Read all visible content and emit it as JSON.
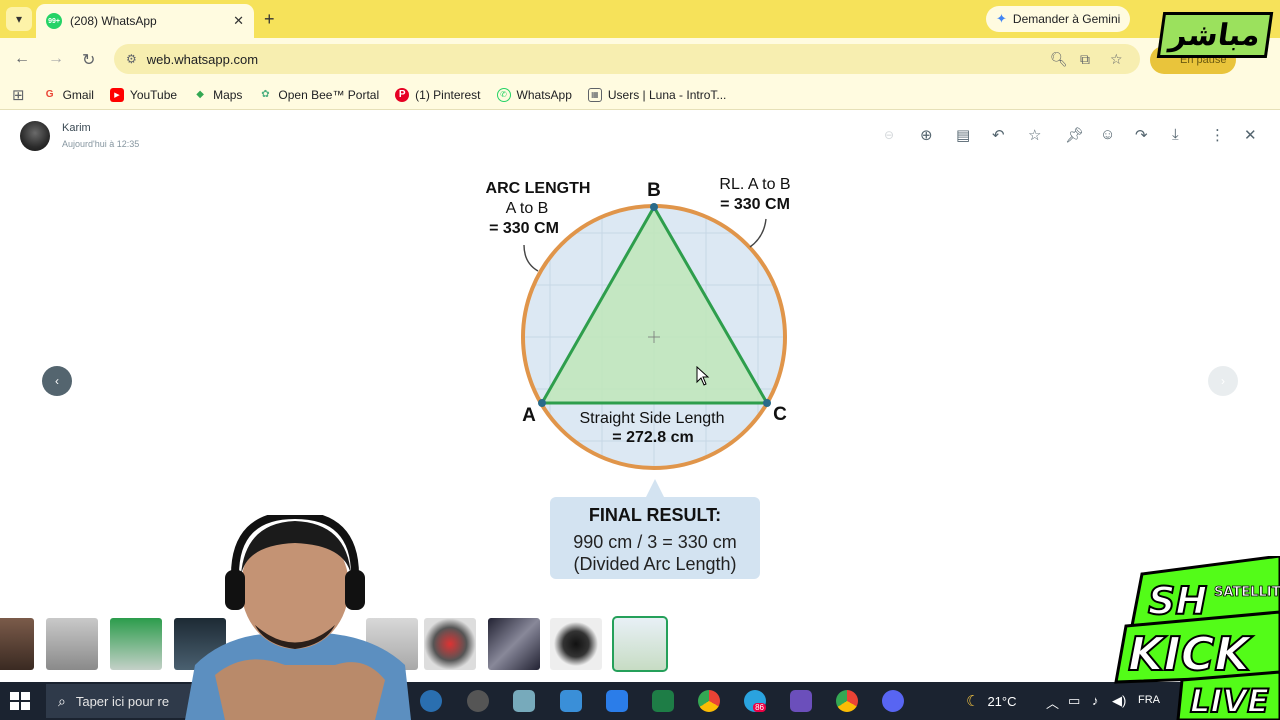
{
  "browser": {
    "tab": {
      "badge": "99+",
      "title": "(208) WhatsApp"
    },
    "gemini_label": "Demander à Gemini",
    "url": "web.whatsapp.com",
    "profile_status": "En pause"
  },
  "bookmarks": [
    {
      "label": "Gmail",
      "icon": "gmail-icon",
      "color": "#ea4335"
    },
    {
      "label": "YouTube",
      "icon": "youtube-icon",
      "color": "#ff0000"
    },
    {
      "label": "Maps",
      "icon": "maps-icon",
      "color": "#34a853"
    },
    {
      "label": "Open Bee™ Portal",
      "icon": "openbee-icon",
      "color": "#4caf80"
    },
    {
      "label": "(1) Pinterest",
      "icon": "pinterest-icon",
      "color": "#e60023"
    },
    {
      "label": "WhatsApp",
      "icon": "whatsapp-icon",
      "color": "#25d366"
    },
    {
      "label": "Users | Luna - IntroT...",
      "icon": "table-icon",
      "color": "#5f6368"
    }
  ],
  "viewer": {
    "sender": "Karim",
    "sent_time": "Aujourd'hui à 12:35"
  },
  "diagram": {
    "vertex_a": "A",
    "vertex_b": "B",
    "vertex_c": "C",
    "arc_line1": "ARC LENGTH",
    "arc_line2": "A to B",
    "arc_line3": "= 330 CM",
    "rl_line1": "RL. A to B",
    "rl_line2": "= 330 CM",
    "side_line1": "Straight Side Length",
    "side_line2": "= 272.8 cm",
    "result_title": "FINAL RESULT:",
    "result_line1": "990 cm / 3 = 330 cm",
    "result_line2": "(Divided Arc Length)"
  },
  "taskbar": {
    "search_placeholder": "Taper ici pour re",
    "temperature": "21°C",
    "language": "FRA",
    "telegram_badge": "86"
  },
  "overlay": {
    "mubasher": "مباشر",
    "kick_top": "SH",
    "kick_satellite": "SATELLITE",
    "kick_word": "KICK",
    "kick_live": "LIVE"
  },
  "colors": {
    "chrome_yellow": "#f6e25a",
    "circle_stroke": "#e0954a",
    "triangle_stroke": "#2e9e4c",
    "triangle_fill": "#bfe6b8",
    "circle_fill": "#dce8f3",
    "kick_green": "#53fc18"
  }
}
